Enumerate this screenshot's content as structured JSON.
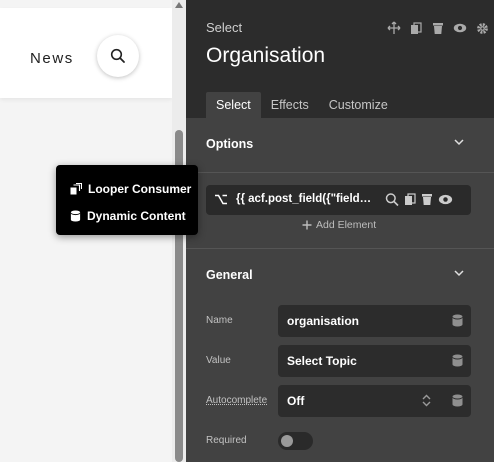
{
  "canvas": {
    "nav": {
      "news_label": "News"
    },
    "icons": {
      "search": "search-icon",
      "scroll_up": "scroll-up-arrow-icon"
    }
  },
  "popup": {
    "items": [
      {
        "label": "Looper Consumer",
        "icon": "looper-consumer-icon"
      },
      {
        "label": "Dynamic Content",
        "icon": "database-icon"
      }
    ]
  },
  "panel": {
    "breadcrumb": "Select",
    "title": "Organisation",
    "header_icons": [
      "move-icon",
      "duplicate-icon",
      "delete-icon",
      "visibility-icon",
      "settings-icon"
    ],
    "tabs": [
      {
        "label": "Select",
        "active": true
      },
      {
        "label": "Effects",
        "active": false
      },
      {
        "label": "Customize",
        "active": false
      }
    ],
    "options": {
      "title": "Options",
      "loop_field": {
        "value": "{{ acf.post_field({\"field\":\"organisation\"}) }}",
        "icons": [
          "search-icon",
          "duplicate-icon",
          "delete-icon",
          "visibility-icon"
        ]
      },
      "add_element_label": "Add Element"
    },
    "general": {
      "title": "General",
      "fields": [
        {
          "label": "Name",
          "value": "organisation"
        },
        {
          "label": "Value",
          "value": "Select Topic"
        },
        {
          "label": "Autocomplete",
          "value": "Off"
        },
        {
          "label": "Required",
          "value": "off"
        }
      ]
    }
  },
  "colors": {
    "panel_bg": "#424242",
    "panel_header_bg": "#2c2c2c",
    "field_bg": "#2c2c2c",
    "popup_bg": "#000000",
    "canvas_bg": "#f4f4f4"
  }
}
